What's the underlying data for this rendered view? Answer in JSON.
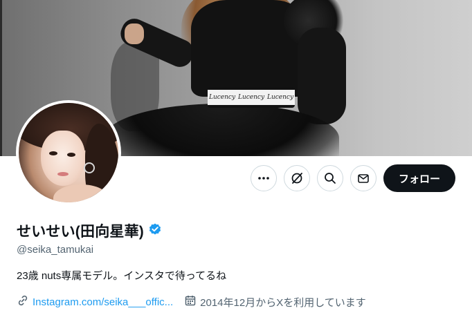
{
  "profile": {
    "display_name": "せいせい(田向星華)",
    "verified": true,
    "handle": "@seika_tamukai",
    "bio": "23歳 nuts専属モデル。インスタで待ってるね",
    "website": "Instagram.com/seika___offic...",
    "joined": "2014年12月からXを利用しています"
  },
  "banner": {
    "belt_text": [
      "Lucency",
      "Lucency",
      "Lucency"
    ]
  },
  "actions": {
    "more_icon": "more-horizontal-icon",
    "grok_icon": "grok-icon",
    "search_icon": "search-icon",
    "message_icon": "envelope-icon",
    "follow_label": "フォロー"
  },
  "colors": {
    "accent_link": "#1d9bf0",
    "verified_badge": "#1d9bf0",
    "follow_button_bg": "#0f1419",
    "secondary_text": "#536471"
  }
}
